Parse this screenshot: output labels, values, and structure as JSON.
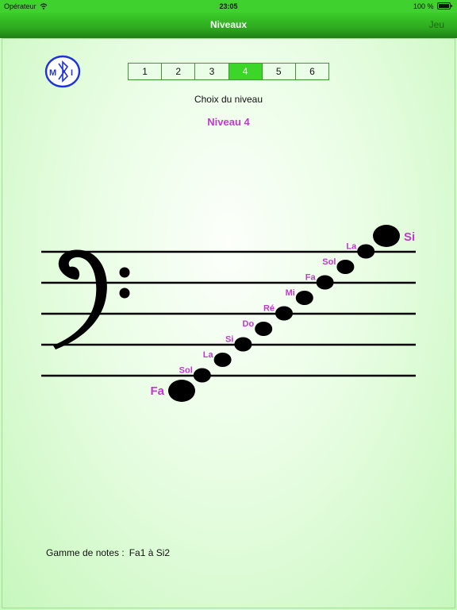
{
  "status": {
    "carrier": "Opérateur",
    "time": "23:05",
    "battery": "100 %"
  },
  "nav": {
    "title": "Niveaux",
    "right_button": "Jeu"
  },
  "levels": [
    "1",
    "2",
    "3",
    "4",
    "5",
    "6"
  ],
  "selected_level_index": 3,
  "choice_label": "Choix du niveau",
  "level_title": "Niveau 4",
  "notes": [
    "Fa",
    "Sol",
    "La",
    "Si",
    "Do",
    "Ré",
    "Mi",
    "Fa",
    "Sol",
    "La",
    "Si"
  ],
  "range": {
    "label": "Gamme de notes :",
    "value": "Fa1 à Si2"
  },
  "colors": {
    "accent": "#3bd629",
    "note_label": "#c13ad0",
    "nav_text": "#ffffff"
  },
  "icons": [
    "midi-bluetooth-icon",
    "wifi-icon",
    "battery-icon",
    "bass-clef-icon"
  ]
}
